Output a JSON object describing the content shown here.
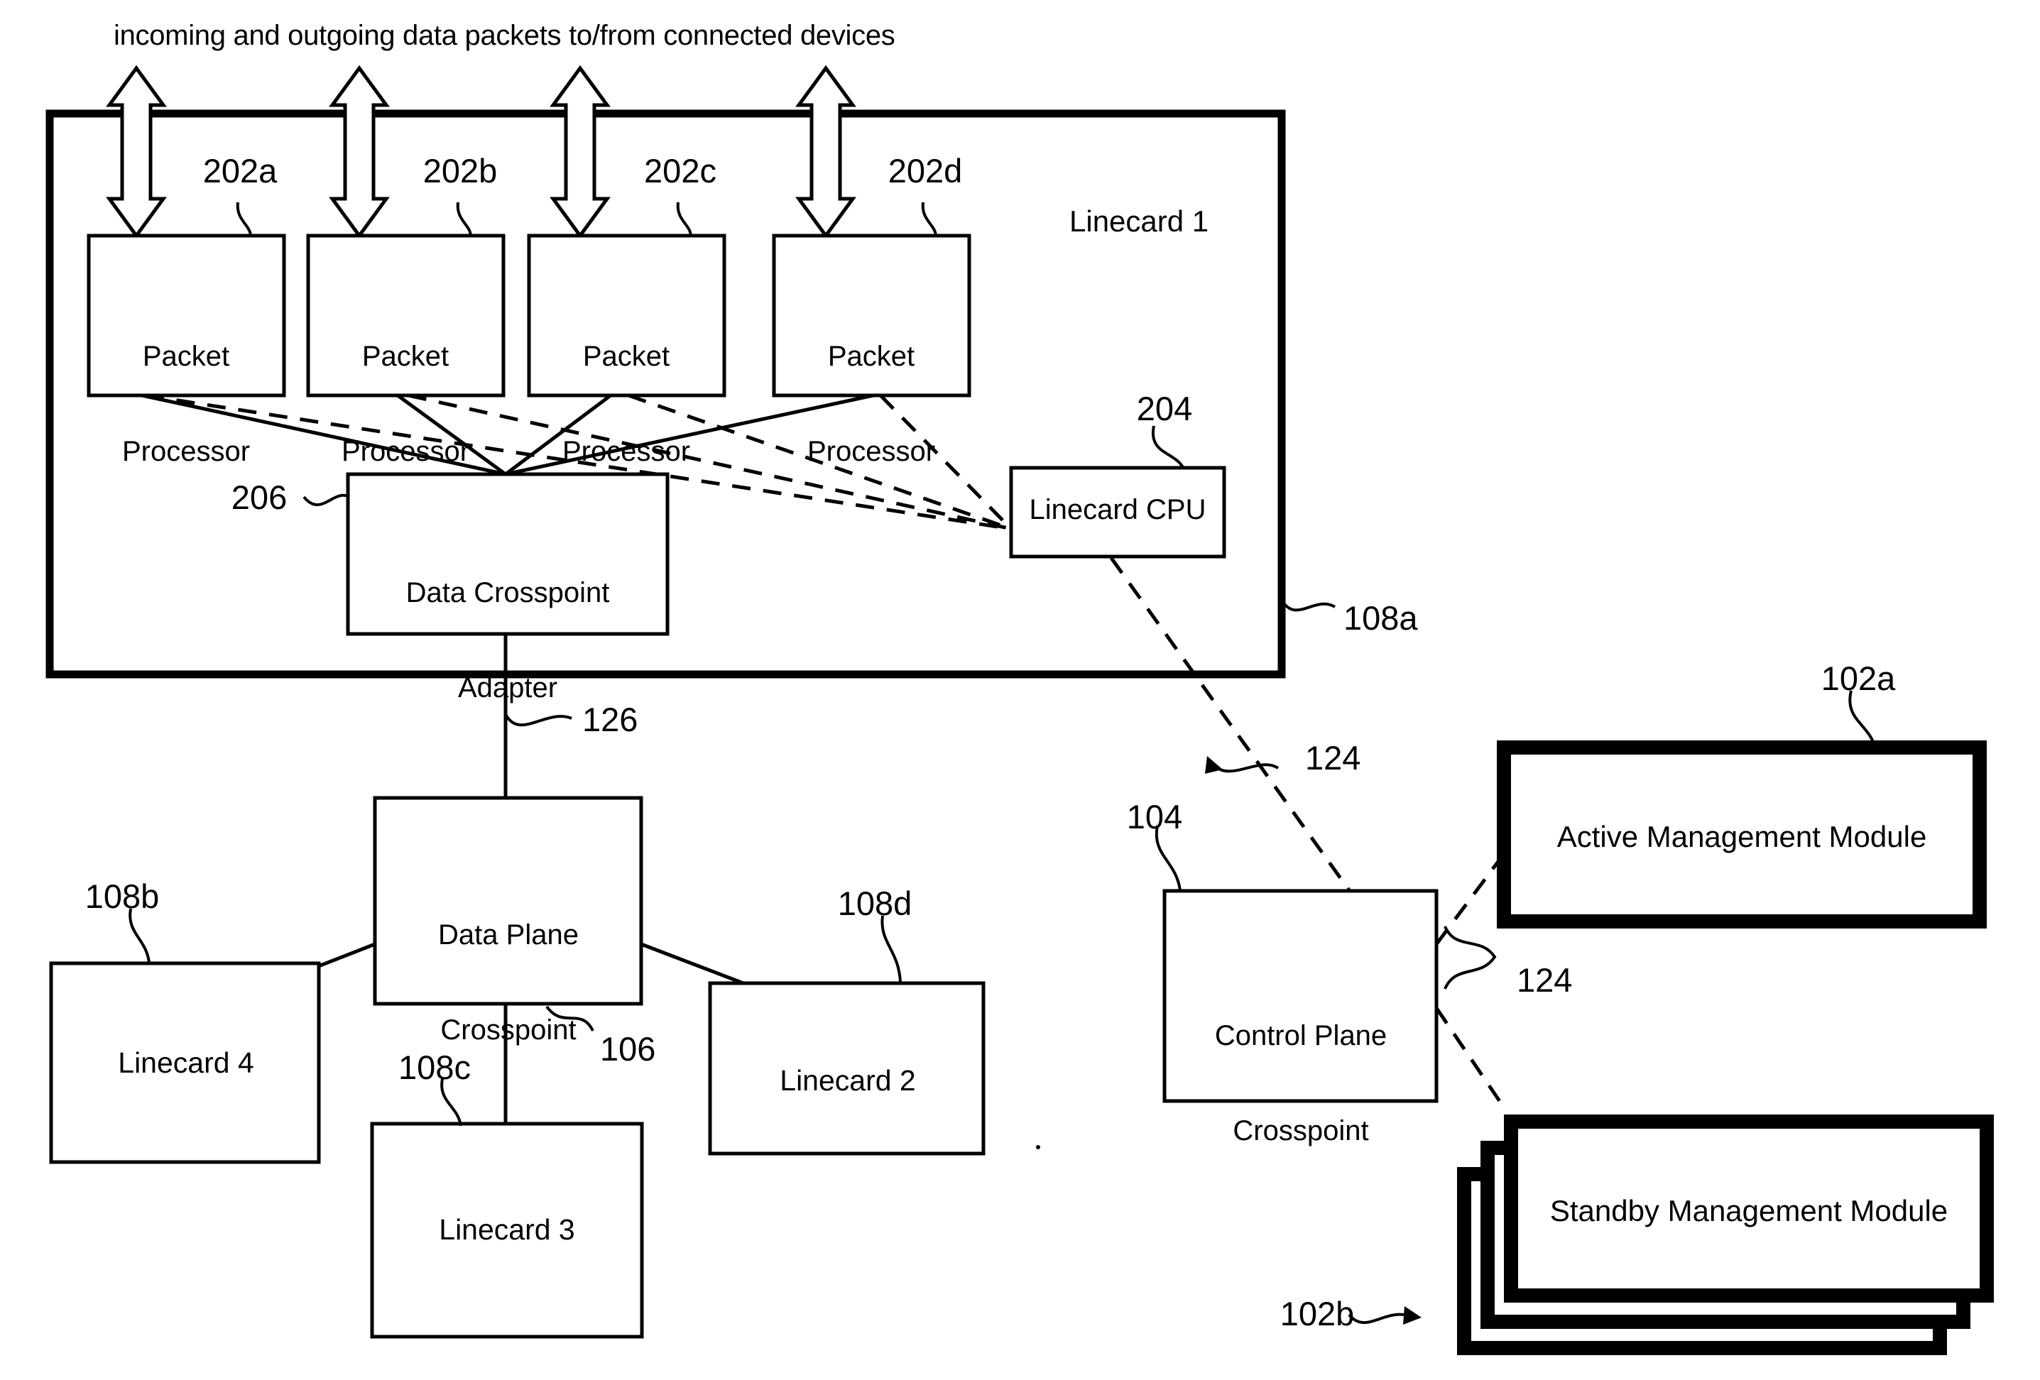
{
  "figure": {
    "caption": "incoming and outgoing data packets to/from connected devices",
    "linecard_label": "Linecard 1"
  },
  "packet_processors": [
    {
      "ref": "202a",
      "line1": "Packet",
      "line2": "Processor"
    },
    {
      "ref": "202b",
      "line1": "Packet",
      "line2": "Processor"
    },
    {
      "ref": "202c",
      "line1": "Packet",
      "line2": "Processor"
    },
    {
      "ref": "202d",
      "line1": "Packet",
      "line2": "Processor"
    }
  ],
  "blocks": {
    "linecard_cpu": {
      "label": "Linecard CPU",
      "ref": "204"
    },
    "data_crosspoint_adapter": {
      "line1": "Data Crosspoint",
      "line2": "Adapter",
      "ref": "206"
    },
    "data_plane_crosspoint": {
      "line1": "Data Plane",
      "line2": "Crosspoint",
      "ref": "106"
    },
    "control_plane_crosspoint": {
      "line1": "Control Plane",
      "line2": "Crosspoint",
      "ref": "104"
    },
    "active_management_module": {
      "label": "Active Management Module",
      "ref": "102a"
    },
    "standby_management_module": {
      "label": "Standby Management Module",
      "ref": "102b"
    }
  },
  "linecards": [
    {
      "label": "Linecard 4",
      "ref": "108b"
    },
    {
      "label": "Linecard 3",
      "ref": "108c"
    },
    {
      "label": "Linecard 2",
      "ref": "108d"
    }
  ],
  "connection_refs": {
    "linecard_1": "108a",
    "data_link_126": "126",
    "control_link_upper": "124",
    "control_link_lower": "124"
  },
  "colors": {
    "stroke": "#000000",
    "background": "#ffffff"
  }
}
